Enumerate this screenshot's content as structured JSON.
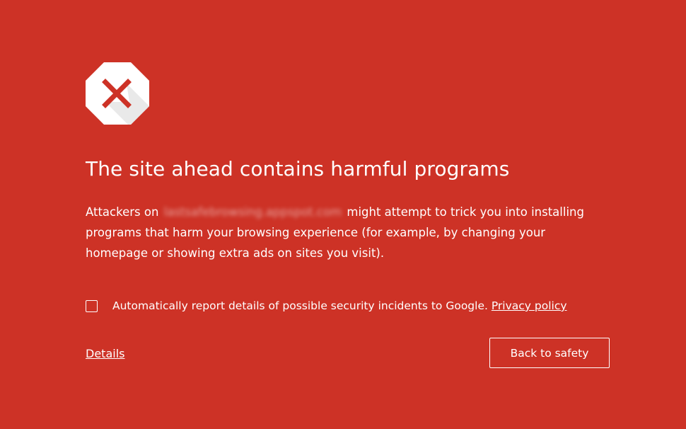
{
  "icon": {
    "name": "warning-stop-icon",
    "shape_color": "#ffffff",
    "x_color": "#cd3226",
    "shadow_color": "#e8e8e8"
  },
  "heading": "The site ahead contains harmful programs",
  "message": {
    "prefix": "Attackers on",
    "blurred_url": "lastsafebrowsing.appspot.com",
    "suffix": "might attempt to trick you into installing programs that harm your browsing experience (for example, by changing your homepage or showing extra ads on sites you visit)."
  },
  "report": {
    "checked": false,
    "text": "Automatically report details of possible security incidents to Google.",
    "privacy_link": "Privacy policy"
  },
  "details_link": "Details",
  "back_button": "Back to safety",
  "colors": {
    "background": "#cd3226",
    "foreground": "#ffffff"
  }
}
